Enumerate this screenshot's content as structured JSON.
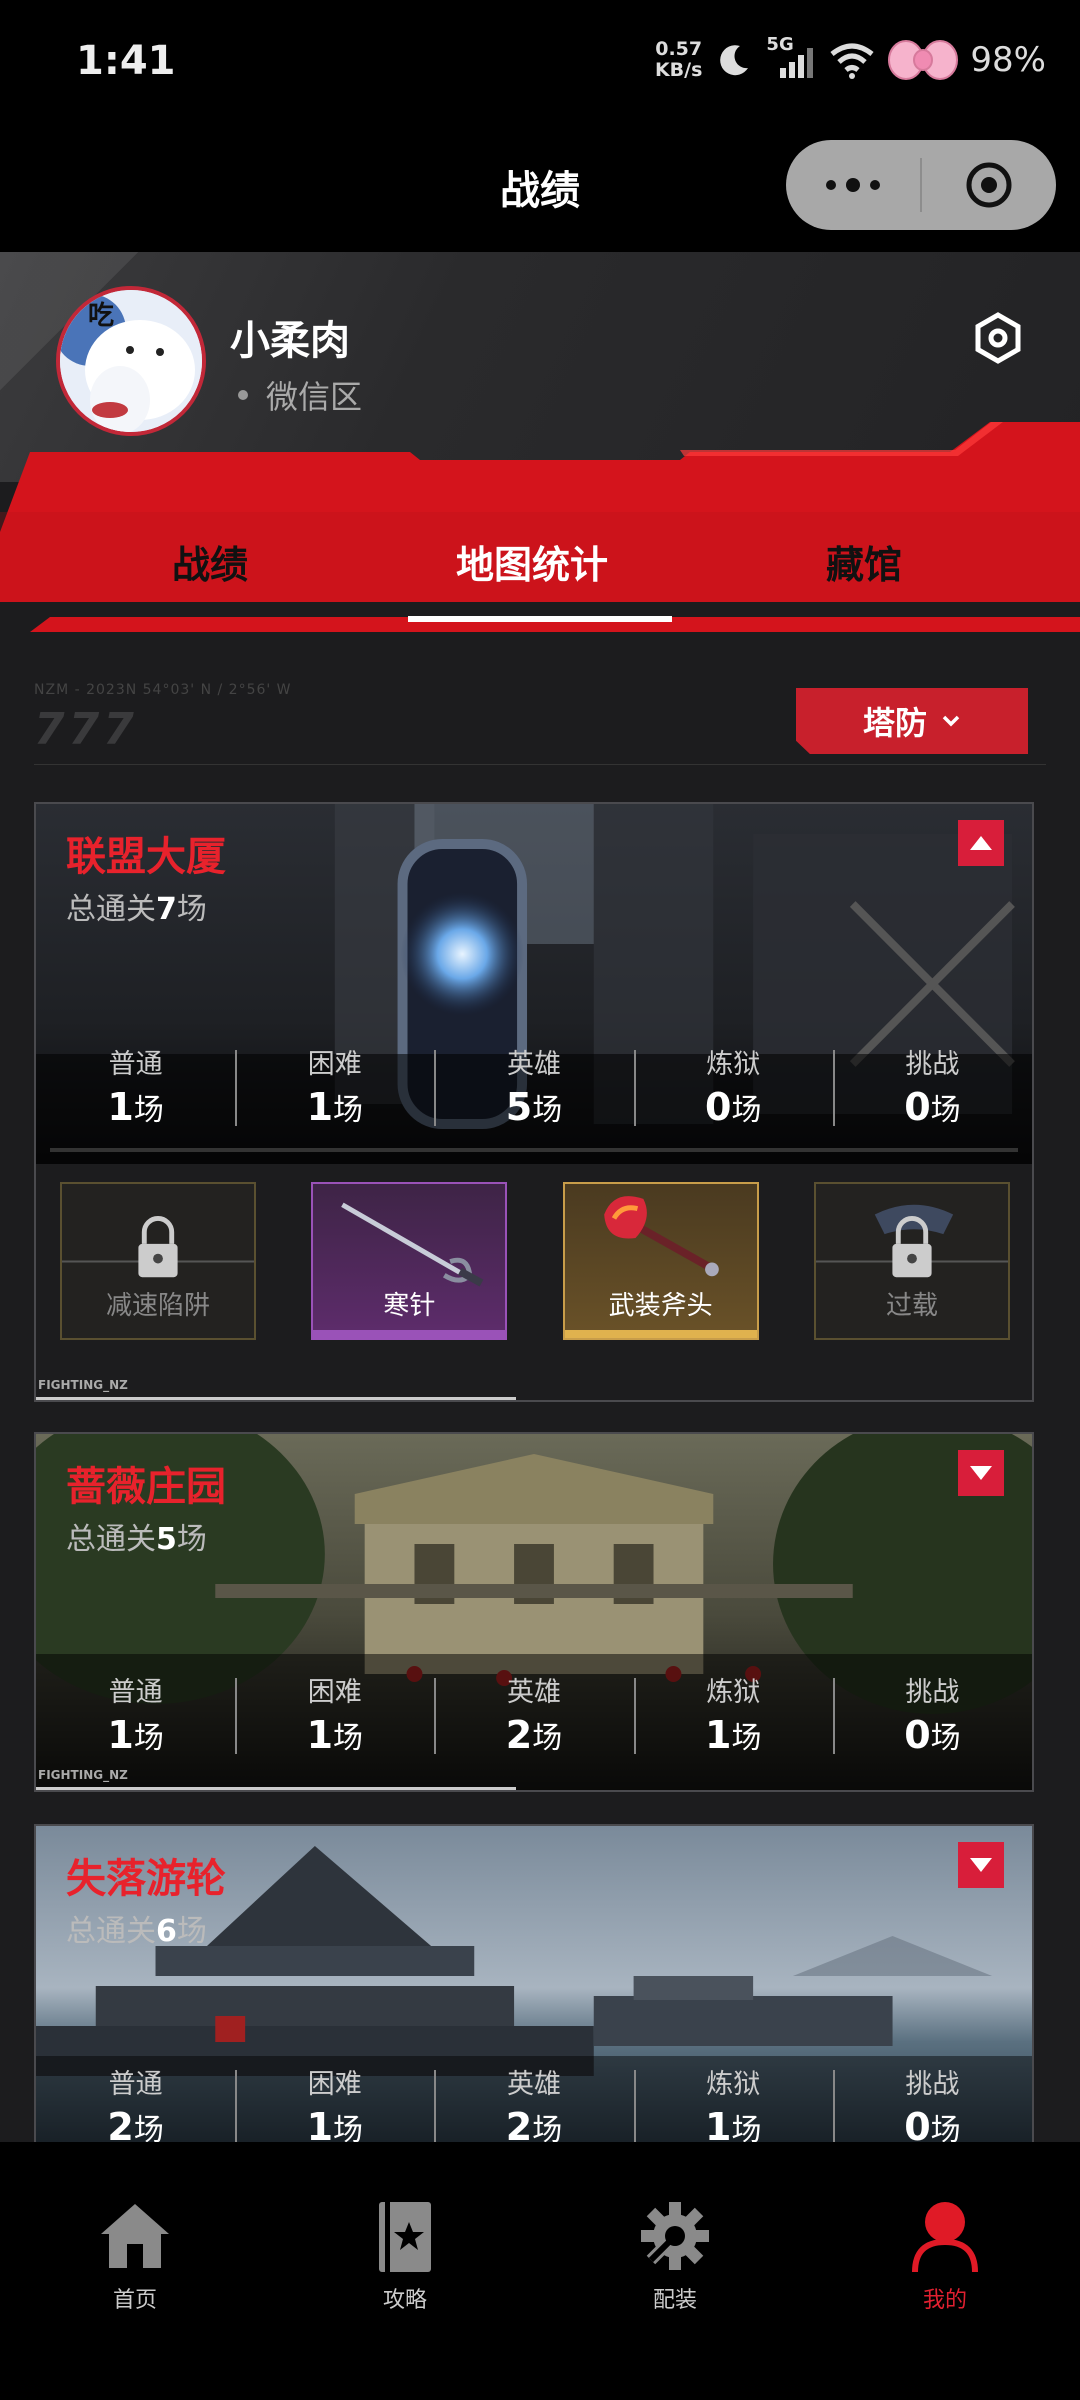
{
  "status_bar": {
    "time": "1:41",
    "net_speed_value": "0.57",
    "net_speed_unit": "KB/s",
    "network": "5G",
    "battery": "98%"
  },
  "nav": {
    "title": "战绩",
    "more_icon": "more-dots-icon",
    "close_icon": "target-circle-icon"
  },
  "profile": {
    "name": "小柔肉",
    "region": "微信区",
    "avatar_text": "吃"
  },
  "tabs": [
    {
      "label": "战绩",
      "active": false
    },
    {
      "label": "地图统计",
      "active": true
    },
    {
      "label": "藏馆",
      "active": false
    }
  ],
  "filter": {
    "deco_text": "NZM - 2023N 54°03' N / 2°56' W",
    "deco_sevens": "777",
    "mode": "塔防"
  },
  "maps": [
    {
      "name": "联盟大厦",
      "total_prefix": "总通关",
      "total_count": "7",
      "total_suffix": "场",
      "expanded": true,
      "stats": [
        {
          "label": "普通",
          "value": "1",
          "unit": "场"
        },
        {
          "label": "困难",
          "value": "1",
          "unit": "场"
        },
        {
          "label": "英雄",
          "value": "5",
          "unit": "场"
        },
        {
          "label": "炼狱",
          "value": "0",
          "unit": "场"
        },
        {
          "label": "挑战",
          "value": "0",
          "unit": "场"
        }
      ],
      "rewards": [
        {
          "label": "减速陷阱",
          "rarity": "locked"
        },
        {
          "label": "寒针",
          "rarity": "purple"
        },
        {
          "label": "武装斧头",
          "rarity": "gold"
        },
        {
          "label": "过载",
          "rarity": "locked"
        }
      ],
      "footer_tag": "FIGHTING_NZ"
    },
    {
      "name": "蔷薇庄园",
      "total_prefix": "总通关",
      "total_count": "5",
      "total_suffix": "场",
      "expanded": false,
      "stats": [
        {
          "label": "普通",
          "value": "1",
          "unit": "场"
        },
        {
          "label": "困难",
          "value": "1",
          "unit": "场"
        },
        {
          "label": "英雄",
          "value": "2",
          "unit": "场"
        },
        {
          "label": "炼狱",
          "value": "1",
          "unit": "场"
        },
        {
          "label": "挑战",
          "value": "0",
          "unit": "场"
        }
      ],
      "footer_tag": "FIGHTING_NZ"
    },
    {
      "name": "失落游轮",
      "total_prefix": "总通关",
      "total_count": "6",
      "total_suffix": "场",
      "expanded": false,
      "stats": [
        {
          "label": "普通",
          "value": "2",
          "unit": "场"
        },
        {
          "label": "困难",
          "value": "1",
          "unit": "场"
        },
        {
          "label": "英雄",
          "value": "2",
          "unit": "场"
        },
        {
          "label": "炼狱",
          "value": "1",
          "unit": "场"
        },
        {
          "label": "挑战",
          "value": "0",
          "unit": "场"
        }
      ]
    }
  ],
  "bottom_nav": [
    {
      "label": "首页",
      "icon": "home-icon",
      "active": false
    },
    {
      "label": "攻略",
      "icon": "guide-book-icon",
      "active": false
    },
    {
      "label": "配装",
      "icon": "gear-icon",
      "active": false
    },
    {
      "label": "我的",
      "icon": "person-icon",
      "active": true
    }
  ],
  "colors": {
    "accent_red": "#e8222c",
    "tab_banner_red": "#d4141c",
    "background": "#1c1c1e"
  }
}
